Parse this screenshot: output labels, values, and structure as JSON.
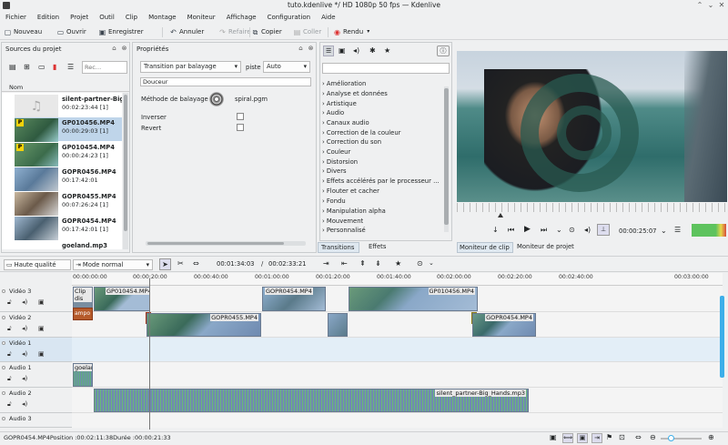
{
  "window": {
    "title": "tuto.kdenlive */ HD 1080p 50 fps — Kdenlive"
  },
  "menu": [
    "Fichier",
    "Edition",
    "Projet",
    "Outil",
    "Clip",
    "Montage",
    "Moniteur",
    "Affichage",
    "Configuration",
    "Aide"
  ],
  "toolbar": {
    "nouveau": "Nouveau",
    "ouvrir": "Ouvrir",
    "enregistrer": "Enregistrer",
    "annuler": "Annuler",
    "refaire": "Refaire",
    "copier": "Copier",
    "coller": "Coller",
    "rendu": "Rendu"
  },
  "project_bin": {
    "title": "Sources du projet",
    "search_placeholder": "Rec…",
    "column": "Nom",
    "clips": [
      {
        "name": "silent-partner-Big_Han",
        "dur": "00:02:23:44 [1]"
      },
      {
        "name": "GP010456.MP4",
        "dur": "00:00:29:03 [1]"
      },
      {
        "name": "GP010454.MP4",
        "dur": "00:00:24:23 [1]"
      },
      {
        "name": "GOPR0456.MP4",
        "dur": "00:17:42:01"
      },
      {
        "name": "GOPR0455.MP4",
        "dur": "00:07:26:24 [1]"
      },
      {
        "name": "GOPR0454.MP4",
        "dur": "00:17:42:01 [1]"
      },
      {
        "name": "goeland.mp3",
        "dur": "00:00:00:00"
      }
    ]
  },
  "properties": {
    "title": "Propriétés",
    "transition": "Transition par balayage",
    "piste_label": "piste",
    "piste_value": "Auto",
    "softness": "Douceur",
    "method_label": "Méthode de balayage",
    "method_value": "spiral.pgm",
    "inverser": "Inverser",
    "revert": "Revert"
  },
  "effects": {
    "categories": [
      "Amélioration",
      "Analyse et données",
      "Artistique",
      "Audio",
      "Canaux audio",
      "Correction de la couleur",
      "Correction du son",
      "Couleur",
      "Distorsion",
      "Divers",
      "Effets accélérés par le processeur ...",
      "Flouter et cacher",
      "Fondu",
      "Manipulation alpha",
      "Mouvement",
      "Personnalisé"
    ],
    "tabs": [
      "Transitions",
      "Effets"
    ]
  },
  "monitor": {
    "timecode": "00:00:25:07",
    "tabs": [
      "Moniteur de clip",
      "Moniteur de projet"
    ]
  },
  "timeline_toolbar": {
    "quality": "Haute qualité",
    "mode": "Mode normal",
    "position": "00:01:34:03",
    "duration": "00:02:33:21"
  },
  "ruler": [
    "00:00:00:00",
    "00:00:20:00",
    "00:00:40:00",
    "00:01:00:00",
    "00:01:20:00",
    "00:01:40:00",
    "00:02:00:00",
    "00:02:20:00",
    "00:02:40:00",
    "00:03:00:00"
  ],
  "tracks": [
    "Vidéo 3",
    "Vidéo 2",
    "Vidéo 1",
    "Audio 1",
    "Audio 2",
    "Audio 3"
  ],
  "timeline_clips": {
    "clip_dis": "Clip dis",
    "transition_label": "ampo",
    "gp010454": "GP010454.MP4",
    "gopr0454a": "GOPR0454.MP4",
    "gp010456": "GP010456.MP4",
    "gopr0455": "GOPR0455.MP4",
    "gopr0454b": "GOPR0454.MP4",
    "goeland": "goelan",
    "silent": "silent_partner-Big_Hands.mp3"
  },
  "status": {
    "text": "GOPR0454.MP4Position :00:02:11:38Durée :00:00:21:33"
  },
  "colors": {
    "accent": "#3daee9",
    "audio": "#6f8ab0",
    "video": "#8aa8c8"
  }
}
